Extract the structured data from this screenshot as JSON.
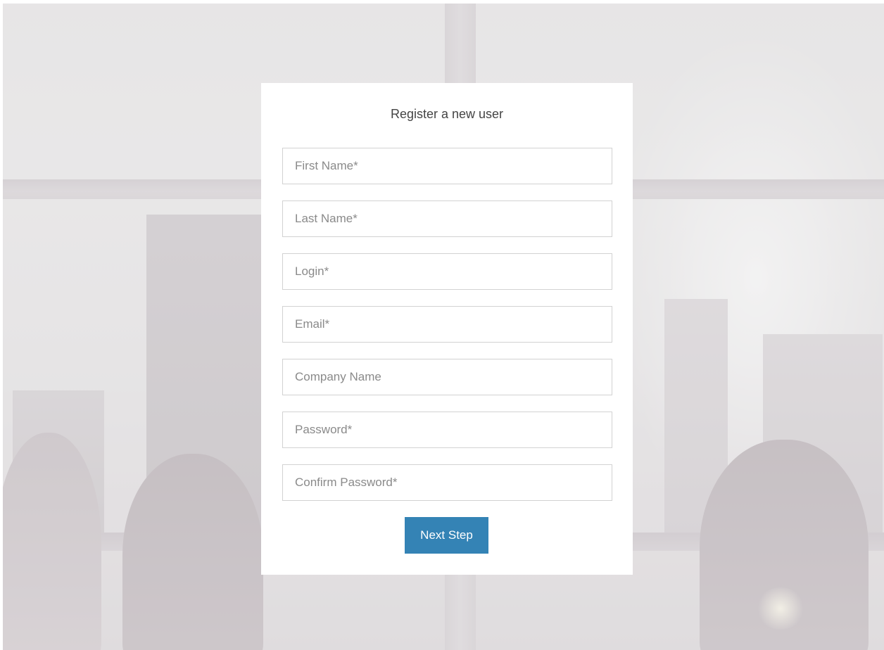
{
  "page": {
    "title": "Register a new user"
  },
  "form": {
    "first_name": {
      "placeholder": "First Name*",
      "value": ""
    },
    "last_name": {
      "placeholder": "Last Name*",
      "value": ""
    },
    "login": {
      "placeholder": "Login*",
      "value": ""
    },
    "email": {
      "placeholder": "Email*",
      "value": ""
    },
    "company": {
      "placeholder": "Company Name",
      "value": ""
    },
    "password": {
      "placeholder": "Password*",
      "value": ""
    },
    "confirm_password": {
      "placeholder": "Confirm Password*",
      "value": ""
    },
    "submit_label": "Next Step"
  },
  "colors": {
    "accent": "#3483b5",
    "card_background": "#ffffff",
    "field_border": "#d2d2d2",
    "placeholder_text": "#8a8a8a"
  }
}
